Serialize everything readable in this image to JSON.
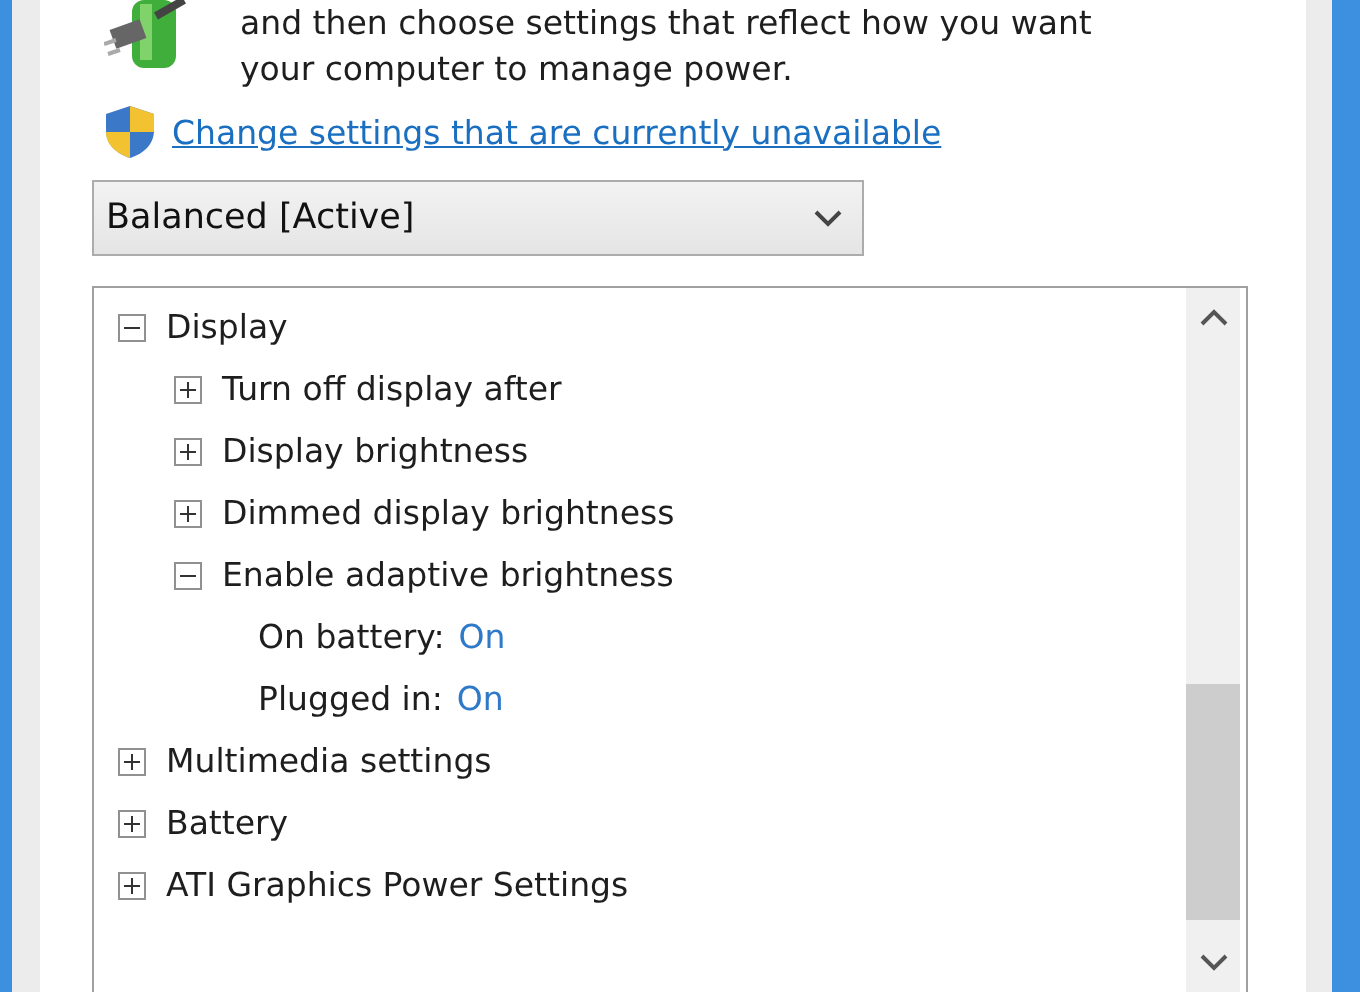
{
  "intro": {
    "lines": [
      "and then choose settings that reflect how you want",
      "your computer to manage power."
    ]
  },
  "link": {
    "label": "Change settings that are currently unavailable"
  },
  "plan_dropdown": {
    "value": "Balanced [Active]"
  },
  "tree": [
    {
      "label": "Display",
      "expanded": true,
      "children": [
        {
          "label": "Turn off display after",
          "expanded": false
        },
        {
          "label": "Display brightness",
          "expanded": false
        },
        {
          "label": "Dimmed display brightness",
          "expanded": false
        },
        {
          "label": "Enable adaptive brightness",
          "expanded": true,
          "children": [
            {
              "label": "On battery:",
              "value": "On"
            },
            {
              "label": "Plugged in:",
              "value": "On"
            }
          ]
        }
      ]
    },
    {
      "label": "Multimedia settings",
      "expanded": false
    },
    {
      "label": "Battery",
      "expanded": false
    },
    {
      "label": "ATI Graphics Power Settings",
      "expanded": false
    }
  ]
}
